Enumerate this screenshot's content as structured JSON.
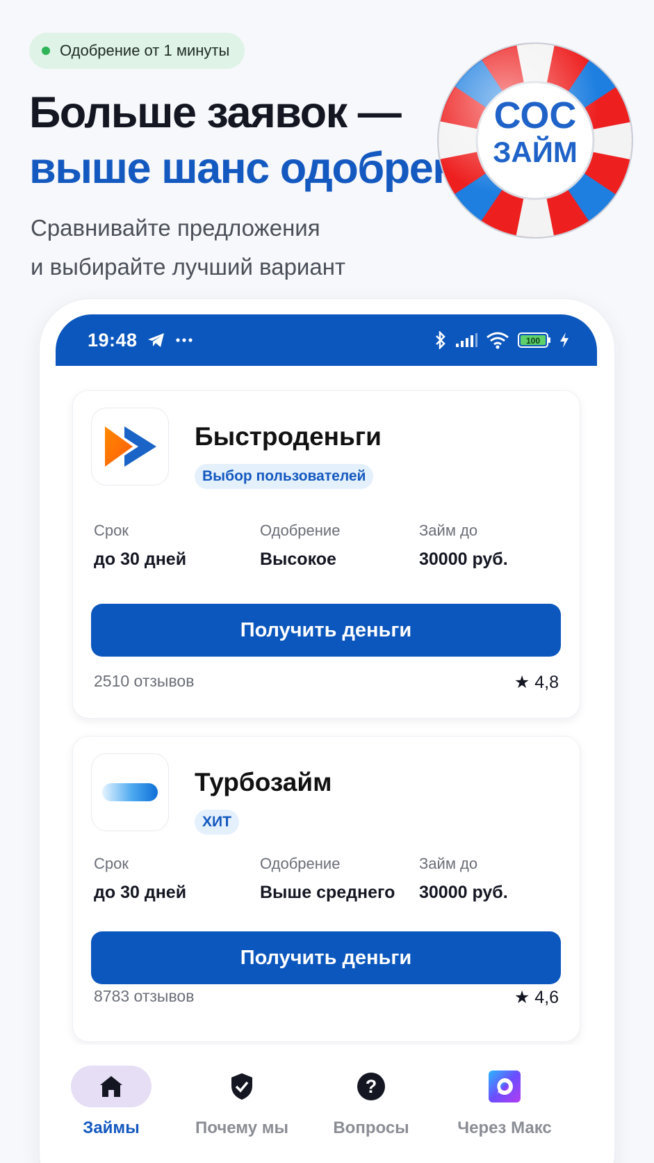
{
  "promo": {
    "badge": "Одобрение от 1 минуты",
    "headline_line1": "Больше заявок —",
    "headline_line2": "выше шанс одобрения",
    "sub_line1": "Сравнивайте предложения",
    "sub_line2": "и выбирайте лучший вариант",
    "logo_line1": "СОС",
    "logo_line2": "ЗАЙМ",
    "colors": {
      "accent": "#1459c0",
      "badge_bg": "#dff3e6",
      "badge_dot": "#2fb457"
    }
  },
  "status_bar": {
    "time": "19:48",
    "battery": "100",
    "icons": [
      "telegram-icon",
      "more-dots-icon",
      "bluetooth-icon",
      "signal-icon",
      "wifi-icon",
      "battery-icon",
      "charging-icon"
    ],
    "color": "#0c57bd"
  },
  "offers": [
    {
      "name": "Быстроденьги",
      "tag": "Выбор пользователей",
      "term_label": "Срок",
      "term_value": "до 30 дней",
      "approval_label": "Одобрение",
      "approval_value": "Высокое",
      "amount_label": "Займ до",
      "amount_value": "30000 руб.",
      "cta": "Получить деньги",
      "reviews": "2510 отзывов",
      "rating": "★ 4,8"
    },
    {
      "name": "Турбозайм",
      "tag": "ХИТ",
      "term_label": "Срок",
      "term_value": "до 30 дней",
      "approval_label": "Одобрение",
      "approval_value": "Выше среднего",
      "amount_label": "Займ до",
      "amount_value": "30000 руб.",
      "cta": "Получить деньги",
      "reviews": "8783 отзывов",
      "rating": "★ 4,6"
    }
  ],
  "nav": [
    {
      "label": "Займы",
      "icon": "home-icon",
      "active": true
    },
    {
      "label": "Почему мы",
      "icon": "shield-check-icon",
      "active": false
    },
    {
      "label": "Вопросы",
      "icon": "question-icon",
      "active": false
    },
    {
      "label": "Через Макс",
      "icon": "max-app-icon",
      "active": false
    }
  ]
}
